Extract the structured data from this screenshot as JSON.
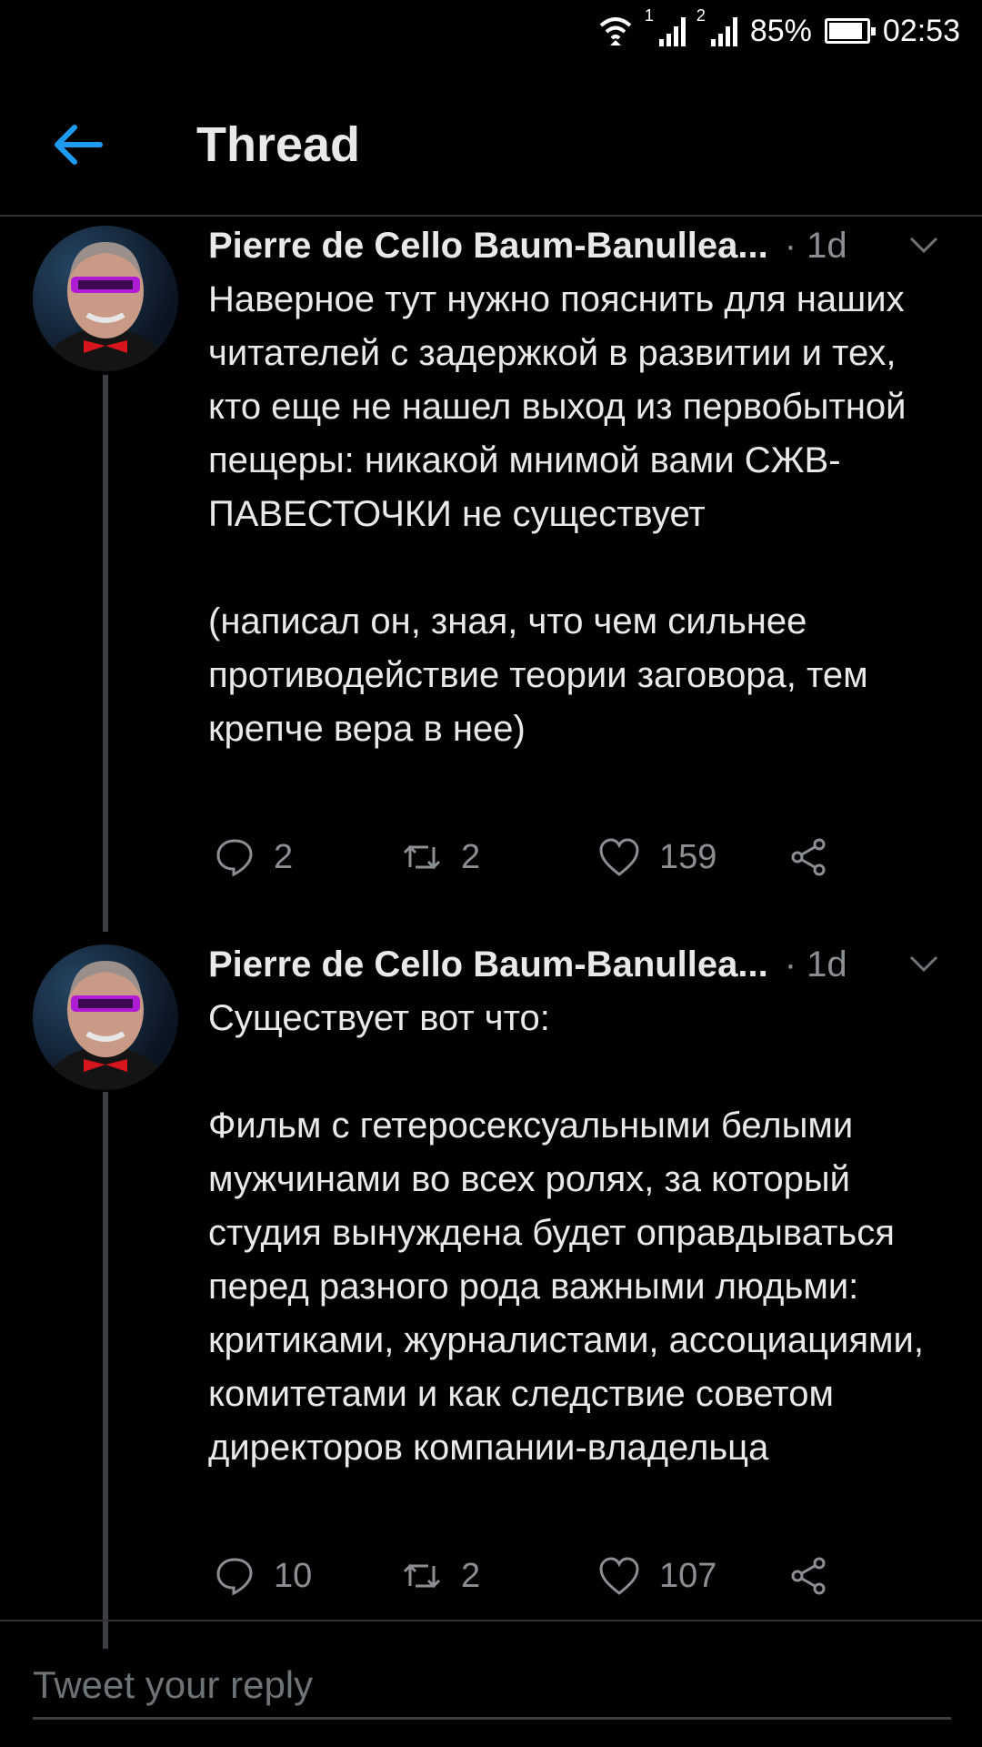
{
  "status_bar": {
    "sim1": "1",
    "sim2": "2",
    "battery": "85%",
    "time": "02:53"
  },
  "header": {
    "title": "Thread"
  },
  "tweets": [
    {
      "author": "Pierre de Cello Baum-Banullea...",
      "time": "· 1d",
      "text": "Наверное тут нужно пояснить для наших читателей с задержкой в развитии и тех, кто еще не нашел выход из первобытной пещеры: никакой мнимой вами СЖВ-ПАВЕСТОЧКИ не существует\n\n(написал он, зная, что чем сильнее противодействие теории заговора, тем крепче вера в нее)",
      "replies": "2",
      "retweets": "2",
      "likes": "159"
    },
    {
      "author": "Pierre de Cello Baum-Banullea...",
      "time": "· 1d",
      "text": "Существует вот что:\n\nФильм с гетеросексуальными белыми мужчинами во всех ролях, за который студия вынуждена будет оправдываться перед разного рода важными людьми: критиками, журналистами, ассоциациями, комитетами и как следствие советом директоров компании-владельца",
      "replies": "10",
      "retweets": "2",
      "likes": "107"
    }
  ],
  "reply": {
    "placeholder": "Tweet your reply"
  },
  "colors": {
    "background": "#000000",
    "accent": "#1d9bf0",
    "muted": "#8b8f93",
    "bow_tie": "#d8141e",
    "glasses": "#b01cd6"
  }
}
